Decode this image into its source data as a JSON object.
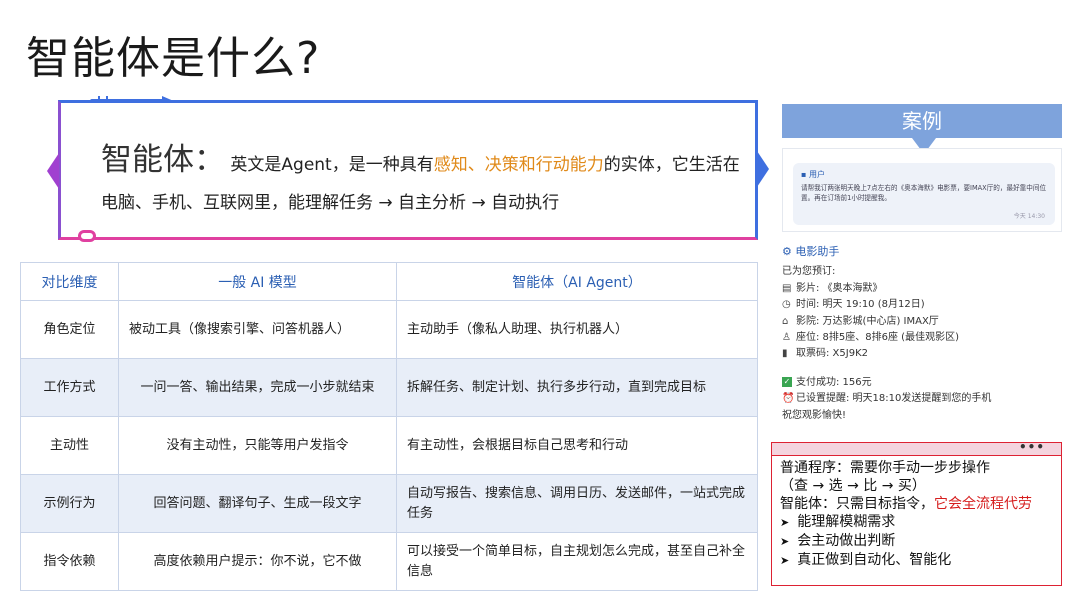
{
  "title": "智能体是什么?",
  "definition": {
    "term": "智能体：",
    "text_a": "英文是Agent，是一种具有",
    "highlight": "感知、决策和行动能力",
    "text_b": "的实体，它生活在电脑、手机、互联网里，能理解任务 → 自主分析 → 自动执行"
  },
  "table": {
    "headers": [
      "对比维度",
      "一般 AI 模型",
      "智能体（AI Agent）"
    ],
    "rows": [
      {
        "dim": "角色定位",
        "ai": "被动工具（像搜索引擎、问答机器人）",
        "agent": "主动助手（像私人助理、执行机器人）"
      },
      {
        "dim": "工作方式",
        "ai": "一问一答、输出结果，完成一小步就结束",
        "agent": "拆解任务、制定计划、执行多步行动，直到完成目标"
      },
      {
        "dim": "主动性",
        "ai": "没有主动性，只能等用户发指令",
        "agent": "有主动性，会根据目标自己思考和行动"
      },
      {
        "dim": "示例行为",
        "ai": "回答问题、翻译句子、生成一段文字",
        "agent": "自动写报告、搜索信息、调用日历、发送邮件，一站式完成任务"
      },
      {
        "dim": "指令依赖",
        "ai": "高度依赖用户提示：你不说，它不做",
        "agent": "可以接受一个简单目标，自主规划怎么完成，甚至自己补全信息"
      }
    ]
  },
  "case": {
    "header": "案例",
    "user_name": "用户",
    "user_msg": "请帮我订两张明天晚上7点左右的《奥本海默》电影票，要IMAX厅的，最好靠中间位置。再在订场前1小时提醒我。",
    "user_time": "今天 14:30",
    "assistant_name": "电影助手",
    "booked": "已为您预订:",
    "movie": "影片: 《奥本海默》",
    "time": "时间: 明天 19:10 (8月12日)",
    "cinema": "影院: 万达影城(中心店) IMAX厅",
    "seats": "座位: 8排5座、8排6座 (最佳观影区)",
    "code": "取票码: X5J9K2",
    "paid": "支付成功: 156元",
    "reminder": "已设置提醒: 明天18:10发送提醒到您的手机",
    "wish": "祝您观影愉快!"
  },
  "summary": {
    "dots": "•••",
    "line1": "普通程序：需要你手动一步步操作",
    "line2": "（查 → 选 → 比 → 买）",
    "line3a": "智能体：只需目标指令，",
    "line3b": "它会全流程代劳",
    "bullets": [
      "能理解模糊需求",
      "会主动做出判断",
      "真正做到自动化、智能化"
    ]
  },
  "colors": {
    "accent_blue": "#3e6fe0",
    "accent_pink": "#e040a0",
    "highlight_orange": "#e08a1a",
    "summary_red": "#d61e1e",
    "case_header": "#7ea3dc"
  }
}
